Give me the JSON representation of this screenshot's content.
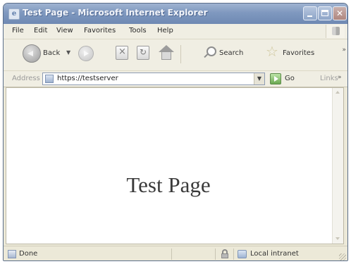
{
  "window": {
    "title": "Test Page - Microsoft Internet Explorer"
  },
  "menu": {
    "items": [
      {
        "label": "File"
      },
      {
        "label": "Edit"
      },
      {
        "label": "View"
      },
      {
        "label": "Favorites"
      },
      {
        "label": "Tools"
      },
      {
        "label": "Help"
      }
    ]
  },
  "toolbar": {
    "back_label": "Back",
    "search_label": "Search",
    "favorites_label": "Favorites"
  },
  "address": {
    "label": "Address",
    "url": "https://testserver",
    "go_label": "Go",
    "links_label": "Links"
  },
  "content": {
    "heading": "Test Page"
  },
  "status": {
    "text": "Done",
    "zone": "Local intranet"
  }
}
